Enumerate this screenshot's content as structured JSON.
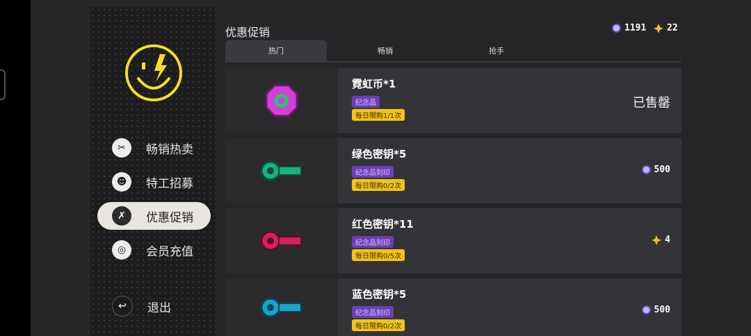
{
  "page_title": "优惠促销",
  "currency": {
    "gems": "1191",
    "gold": "22"
  },
  "nav": [
    {
      "label": "畅销热卖",
      "icon": "ticket-icon"
    },
    {
      "label": "特工招募",
      "icon": "agent-icon"
    },
    {
      "label": "优惠促销",
      "icon": "discount-icon",
      "active": true
    },
    {
      "label": "会员充值",
      "icon": "vip-icon"
    },
    {
      "label": "退出",
      "icon": "exit-icon"
    }
  ],
  "tabs": [
    "热门",
    "畅销",
    "抢手"
  ],
  "items": [
    {
      "name": "霓虹币*1",
      "tag": "纪念品",
      "limit": "每日限购1/1次",
      "status": "已售罄",
      "icon": "neon-coin-icon",
      "color": "#d43fd6"
    },
    {
      "name": "绿色密钥*5",
      "tag": "纪念品刻印",
      "limit": "每日限购0/2次",
      "price": "500",
      "price_icon": "gem-icon",
      "icon": "green-key-icon",
      "color": "#1fae7e"
    },
    {
      "name": "红色密钥*11",
      "tag": "纪念品刻印",
      "limit": "每日限购0/5次",
      "price": "4",
      "price_icon": "gold-icon",
      "icon": "red-key-icon",
      "color": "#d2245c"
    },
    {
      "name": "蓝色密钥*5",
      "tag": "纪念品刻印",
      "limit": "每日限购0/2次",
      "price": "500",
      "price_icon": "gem-icon",
      "icon": "blue-key-icon",
      "color": "#1aa3c8"
    }
  ],
  "colors": {
    "accent": "#f2c419",
    "purple": "#6b3fb6",
    "active_bg": "#e9e6df"
  }
}
